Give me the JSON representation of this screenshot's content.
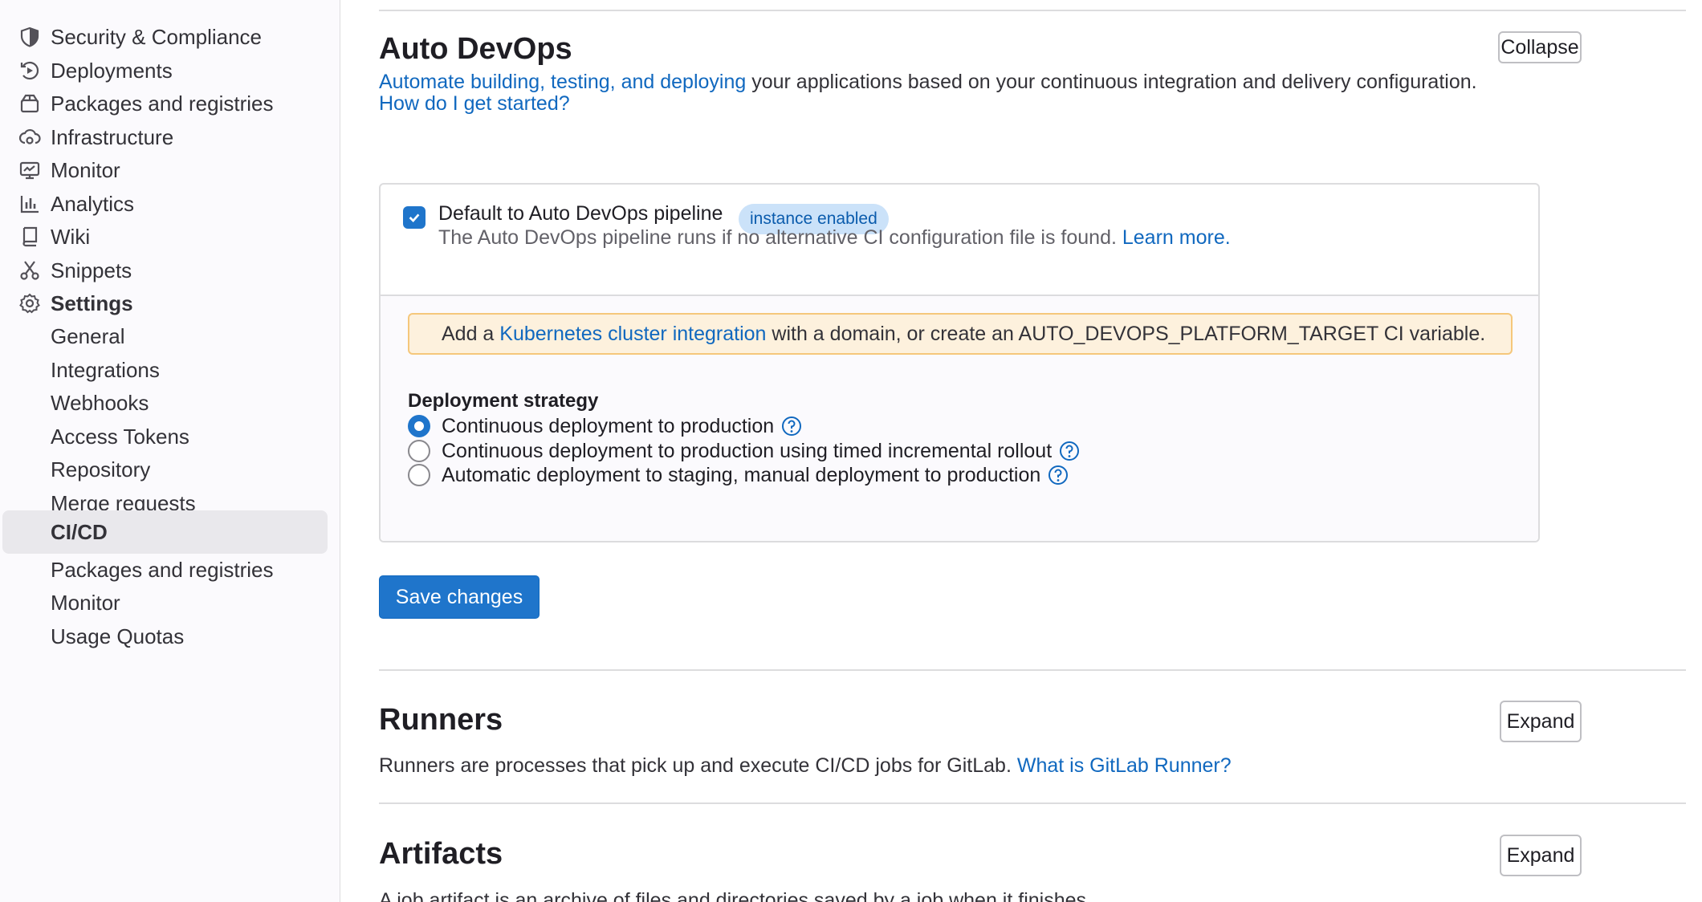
{
  "sidebar": {
    "items": [
      {
        "label": "Security & Compliance",
        "icon": "shield-icon"
      },
      {
        "label": "Deployments",
        "icon": "deployments-icon"
      },
      {
        "label": "Packages and registries",
        "icon": "package-icon"
      },
      {
        "label": "Infrastructure",
        "icon": "cloud-gear-icon"
      },
      {
        "label": "Monitor",
        "icon": "monitor-icon"
      },
      {
        "label": "Analytics",
        "icon": "chart-icon"
      },
      {
        "label": "Wiki",
        "icon": "book-icon"
      },
      {
        "label": "Snippets",
        "icon": "scissors-icon"
      },
      {
        "label": "Settings",
        "icon": "gear-icon"
      }
    ],
    "settings_subitems": [
      "General",
      "Integrations",
      "Webhooks",
      "Access Tokens",
      "Repository",
      "Merge requests",
      "CI/CD",
      "Packages and registries",
      "Monitor",
      "Usage Quotas"
    ],
    "active_subitem": "CI/CD"
  },
  "auto_devops": {
    "title": "Auto DevOps",
    "collapse_label": "Collapse",
    "description_link": "Automate building, testing, and deploying",
    "description_rest": "your applications based on your continuous integration and delivery configuration.",
    "started_link": "How do I get started?",
    "checkbox_label": "Default to Auto DevOps pipeline",
    "checkbox_checked": true,
    "badge": "instance enabled",
    "help_text": "The Auto DevOps pipeline runs if no alternative CI configuration file is found.",
    "learn_more": "Learn more.",
    "alert": {
      "prefix": "Add a",
      "link": "Kubernetes cluster integration",
      "suffix": "with a domain, or create an AUTO_DEVOPS_PLATFORM_TARGET CI variable."
    },
    "strategy_title": "Deployment strategy",
    "strategies": [
      {
        "label": "Continuous deployment to production",
        "checked": true
      },
      {
        "label": "Continuous deployment to production using timed incremental rollout",
        "checked": false
      },
      {
        "label": "Automatic deployment to staging, manual deployment to production",
        "checked": false
      }
    ],
    "save_label": "Save changes"
  },
  "runners": {
    "title": "Runners",
    "expand_label": "Expand",
    "description": "Runners are processes that pick up and execute CI/CD jobs for GitLab.",
    "link": "What is GitLab Runner?"
  },
  "artifacts": {
    "title": "Artifacts",
    "expand_label": "Expand",
    "description": "A job artifact is an archive of files and directories saved by a job when it finishes."
  },
  "colors": {
    "primary": "#1f75cb",
    "link": "#1068bf",
    "alert_bg": "#fdf1dd",
    "badge_bg": "#cbe2f9"
  }
}
